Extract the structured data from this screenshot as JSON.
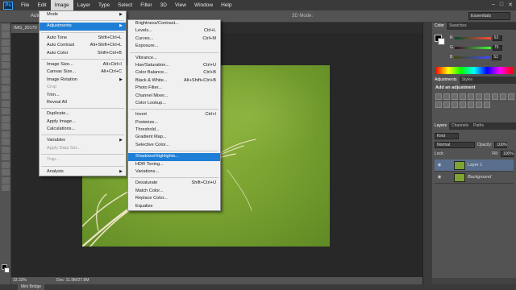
{
  "menubar": {
    "logo": "Ps",
    "items": [
      "File",
      "Edit",
      "Image",
      "Layer",
      "Type",
      "Select",
      "Filter",
      "3D",
      "View",
      "Window",
      "Help"
    ],
    "active": "Image"
  },
  "options": {
    "text": "Auto",
    "mode3d": "3D Mode:",
    "workspace": "Essentials"
  },
  "document": {
    "tab_label": "IMG_20170",
    "zoom": "33.33%",
    "doc_size": "Doc: 11.9M/27.8M"
  },
  "bottom_tab": "Mini Bridge",
  "image_menu": [
    {
      "label": "Mode",
      "submenu": true
    },
    {
      "sep": true
    },
    {
      "label": "Adjustments",
      "submenu": true,
      "highlight": true
    },
    {
      "sep": true
    },
    {
      "label": "Auto Tone",
      "shortcut": "Shift+Ctrl+L"
    },
    {
      "label": "Auto Contrast",
      "shortcut": "Alt+Shift+Ctrl+L"
    },
    {
      "label": "Auto Color",
      "shortcut": "Shift+Ctrl+B"
    },
    {
      "sep": true
    },
    {
      "label": "Image Size...",
      "shortcut": "Alt+Ctrl+I"
    },
    {
      "label": "Canvas Size...",
      "shortcut": "Alt+Ctrl+C"
    },
    {
      "label": "Image Rotation",
      "submenu": true
    },
    {
      "label": "Crop",
      "disabled": true
    },
    {
      "label": "Trim..."
    },
    {
      "label": "Reveal All"
    },
    {
      "sep": true
    },
    {
      "label": "Duplicate..."
    },
    {
      "label": "Apply Image..."
    },
    {
      "label": "Calculations..."
    },
    {
      "sep": true
    },
    {
      "label": "Variables",
      "submenu": true
    },
    {
      "label": "Apply Data Set...",
      "disabled": true
    },
    {
      "sep": true
    },
    {
      "label": "Trap...",
      "disabled": true
    },
    {
      "sep": true
    },
    {
      "label": "Analysis",
      "submenu": true
    }
  ],
  "adjust_menu": [
    {
      "label": "Brightness/Contrast..."
    },
    {
      "label": "Levels...",
      "shortcut": "Ctrl+L"
    },
    {
      "label": "Curves...",
      "shortcut": "Ctrl+M"
    },
    {
      "label": "Exposure..."
    },
    {
      "sep": true
    },
    {
      "label": "Vibrance..."
    },
    {
      "label": "Hue/Saturation...",
      "shortcut": "Ctrl+U"
    },
    {
      "label": "Color Balance...",
      "shortcut": "Ctrl+B"
    },
    {
      "label": "Black & White...",
      "shortcut": "Alt+Shift+Ctrl+B"
    },
    {
      "label": "Photo Filter..."
    },
    {
      "label": "Channel Mixer..."
    },
    {
      "label": "Color Lookup..."
    },
    {
      "sep": true
    },
    {
      "label": "Invert",
      "shortcut": "Ctrl+I"
    },
    {
      "label": "Posterize..."
    },
    {
      "label": "Threshold..."
    },
    {
      "label": "Gradient Map..."
    },
    {
      "label": "Selective Color..."
    },
    {
      "sep": true
    },
    {
      "label": "Shadows/Highlights...",
      "highlight": true
    },
    {
      "label": "HDR Toning..."
    },
    {
      "label": "Variations..."
    },
    {
      "sep": true
    },
    {
      "label": "Desaturate",
      "shortcut": "Shift+Ctrl+U"
    },
    {
      "label": "Match Color..."
    },
    {
      "label": "Replace Color..."
    },
    {
      "label": "Equalize"
    }
  ],
  "color_panel": {
    "tabs": [
      "Color",
      "Swatches"
    ],
    "sliders": [
      {
        "label": "R",
        "value": "63"
      },
      {
        "label": "G",
        "value": "75"
      },
      {
        "label": "B",
        "value": "52"
      }
    ]
  },
  "adjust_panel": {
    "tabs": [
      "Adjustments",
      "Styles"
    ],
    "title": "Add an adjustment"
  },
  "layers_panel": {
    "tabs": [
      "Layers",
      "Channels",
      "Paths"
    ],
    "kind": "Kind",
    "blend": "Normal",
    "opacity_label": "Opacity:",
    "opacity": "100%",
    "lock_label": "Lock:",
    "fill_label": "Fill:",
    "fill": "100%",
    "layers": [
      {
        "name": "Layer 1",
        "selected": true
      },
      {
        "name": "Background",
        "selected": false
      }
    ]
  }
}
